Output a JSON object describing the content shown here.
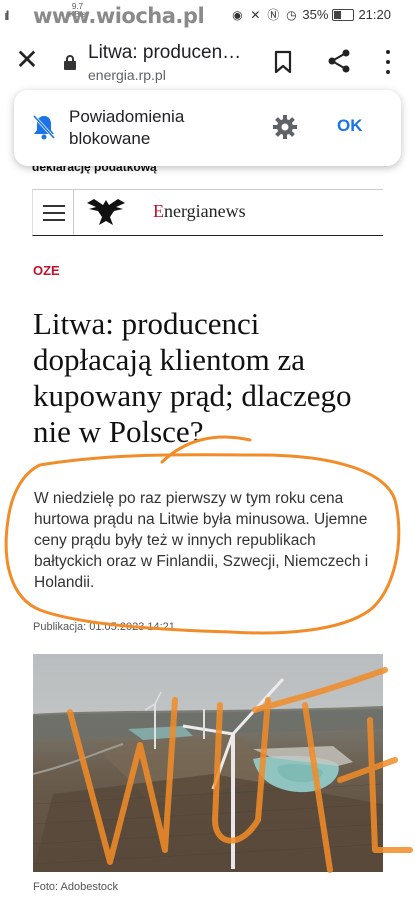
{
  "status_bar": {
    "signal": "ıll",
    "net_speed_value": "9.7",
    "net_speed_unit": "KB/s",
    "battery": "35%",
    "time": "21:20"
  },
  "watermark": "www.wiocha.pl",
  "browser": {
    "tab_title": "Litwa: producen…",
    "domain": "energia.rp.pl"
  },
  "notification": {
    "line1": "Powiadomienia",
    "line2": "blokowane",
    "ok_label": "OK"
  },
  "page_behind_text": "deklarację podatkową",
  "site_header": {
    "brand_first": "E",
    "brand_rest": "nergianews"
  },
  "article": {
    "category": "OZE",
    "headline": "Litwa: producenci dopłacają klientom za kupowany prąd; dlaczego nie w Polsce?",
    "lead": "W niedzielę po raz pierwszy w tym roku cena hurtowa prądu na Litwie była minusowa. Ujemne ceny prądu były też w innych republikach bałtyckich oraz w Finlandii, Szwecji, Niemczech i Holandii.",
    "published": "Publikacja: 01.05.2023 14:21",
    "photo_caption": "Foto: Adobestock"
  },
  "colors": {
    "accent_red": "#c0122e",
    "ok_blue": "#1a73e8",
    "annotation_orange": "#f28c28"
  },
  "icons": [
    "close-icon",
    "lock-icon",
    "bookmark-icon",
    "share-icon",
    "more-vert-icon",
    "bell-off-icon",
    "gear-icon",
    "hamburger-icon",
    "eagle-logo-icon"
  ]
}
